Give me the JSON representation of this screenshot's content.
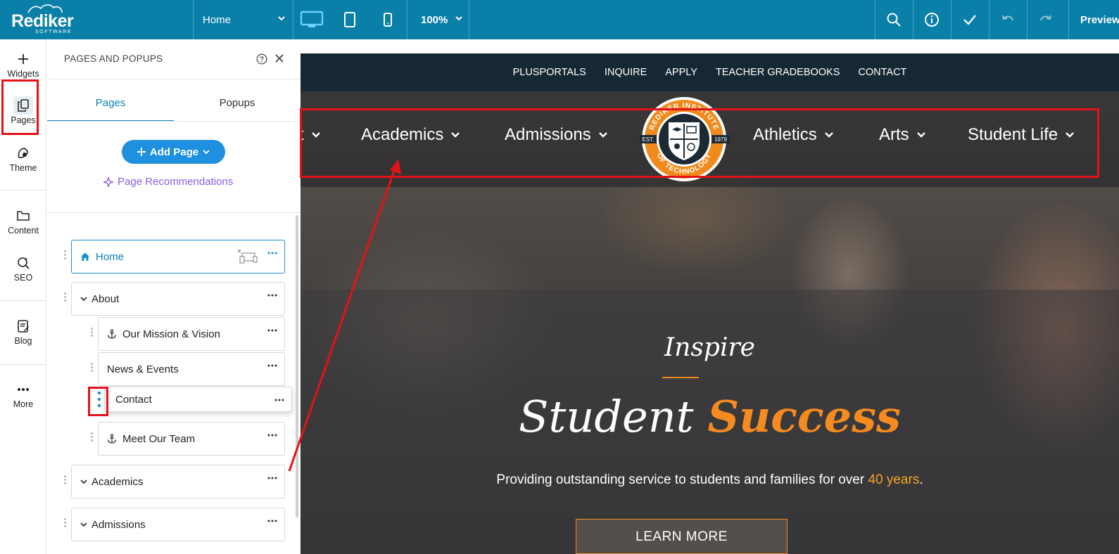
{
  "topbar": {
    "logo_text": "Rediker",
    "logo_sub": "SOFTWARE",
    "page_select": "Home",
    "zoom": "100%",
    "preview_label": "Preview"
  },
  "rail": {
    "widgets": "Widgets",
    "pages": "Pages",
    "theme": "Theme",
    "content": "Content",
    "seo": "SEO",
    "blog": "Blog",
    "more": "More"
  },
  "panel": {
    "title": "PAGES AND POPUPS",
    "tab_pages": "Pages",
    "tab_popups": "Popups",
    "add_page": "Add Page",
    "recommendations": "Page Recommendations",
    "pages": {
      "home": "Home",
      "about": "About",
      "mission": "Our Mission & Vision",
      "news": "News & Events",
      "contact": "Contact",
      "team": "Meet Our Team",
      "academics": "Academics",
      "admissions": "Admissions"
    }
  },
  "site": {
    "utility_nav": [
      "PLUSPORTALS",
      "INQUIRE",
      "APPLY",
      "TEACHER GRADEBOOKS",
      "CONTACT"
    ],
    "main_nav": {
      "partial": "t",
      "academics": "Academics",
      "admissions": "Admissions",
      "athletics": "Athletics",
      "arts": "Arts",
      "student_life": "Student Life"
    },
    "emblem": {
      "top_text": "REDIKER INSTITUTE",
      "bottom_text": "OF TECHNOLOGY",
      "est": "EST.",
      "year": "1979"
    },
    "hero": {
      "inspire": "Inspire",
      "headline_white": "Student",
      "headline_accent": "Success",
      "tagline_pre": "Providing outstanding service to students and families for over",
      "tagline_accent": "40 years",
      "tagline_post": ".",
      "cta": "LEARN MORE"
    }
  },
  "colors": {
    "topbar": "#0a7fa8",
    "accent_blue": "#1f8fe0",
    "accent_orange": "#f58a1f",
    "annotation_red": "#e3121a",
    "recommendation_purple": "#8a5de8"
  }
}
